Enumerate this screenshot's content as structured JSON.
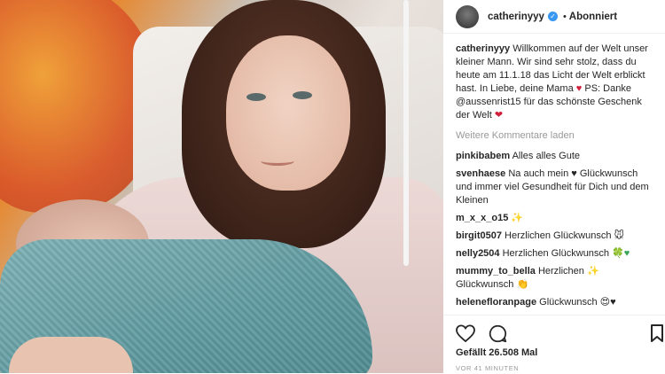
{
  "post": {
    "username": "catherinyyy",
    "follow_label": "Abonniert",
    "caption_user": "catherinyyy",
    "caption_text": "Willkommen auf der Welt unser kleiner Mann. Wir sind sehr stolz, dass du heute am 11.1.18 das Licht der Welt erblickt hast. In Liebe, deine Mama",
    "caption_heart": "♥",
    "caption_ps": "PS: Danke @aussenrist15 für das schönste Geschenk der Welt",
    "caption_ps_heart": "❤",
    "more_comments": "Weitere Kommentare laden"
  },
  "comments": [
    {
      "user": "pinkibabem",
      "text": "Alles alles Gute"
    },
    {
      "user": "svenhaese",
      "text_before": "Na auch mein",
      "emoji": "♥",
      "text_after": "Glückwunsch und immer viel Gesundheit für Dich und dem Kleinen"
    },
    {
      "user": "m_x_x_o15",
      "text": "✨"
    },
    {
      "user": "birgit0507",
      "text": "Herzlichen Glückwunsch 🐭"
    },
    {
      "user": "nelly2504",
      "text": "Herzlichen Glückwunsch",
      "emoji": "🍀♥"
    },
    {
      "user": "mummy_to_bella",
      "text": "Herzlichen ✨ Glückwunsch 👏"
    },
    {
      "user": "helenefloranpage",
      "text": "Glückwunsch 😍♥"
    }
  ],
  "actions": {
    "like_icon": "heart-outline-icon",
    "comment_icon": "comment-bubble-icon",
    "bookmark_icon": "bookmark-icon",
    "likes": "Gefällt 26.508 Mal",
    "timestamp": "VOR 41 MINUTEN"
  }
}
